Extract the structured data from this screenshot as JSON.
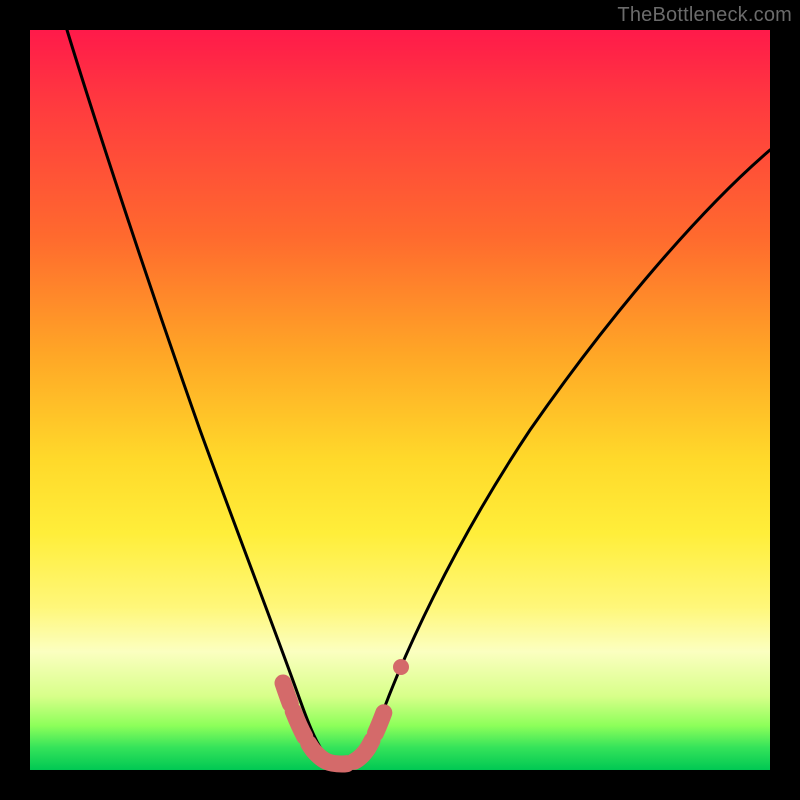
{
  "watermark": "TheBottleneck.com",
  "chart_data": {
    "type": "line",
    "title": "",
    "xlabel": "",
    "ylabel": "",
    "xlim": [
      0,
      100
    ],
    "ylim": [
      0,
      100
    ],
    "series": [
      {
        "name": "bottleneck-curve",
        "x": [
          5,
          8,
          12,
          16,
          20,
          24,
          28,
          31,
          33,
          35,
          36.5,
          38,
          39.5,
          41,
          42.5,
          44,
          46,
          48,
          54,
          62,
          72,
          84,
          100
        ],
        "y": [
          100,
          90,
          79,
          68,
          56,
          44,
          31,
          20,
          13,
          7,
          4,
          2,
          1.2,
          1.2,
          2,
          4,
          8,
          13,
          24,
          37,
          50,
          62,
          76
        ]
      },
      {
        "name": "highlight-band",
        "x": [
          33.5,
          35,
          36.5,
          38,
          39.5,
          41,
          42.5,
          44.5,
          46,
          47.5
        ],
        "y": [
          10,
          5,
          2.5,
          1.2,
          1.2,
          1.2,
          2.5,
          6,
          10,
          14
        ]
      }
    ],
    "colors": {
      "curve": "#000000",
      "highlight": "#d46a6a",
      "background_top": "#ff1a4a",
      "background_bottom": "#00c853"
    }
  }
}
